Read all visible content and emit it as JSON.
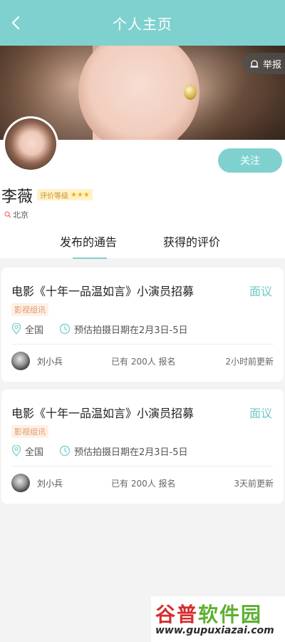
{
  "header": {
    "title": "个人主页"
  },
  "cover": {
    "report_label": "举报"
  },
  "profile": {
    "name": "李薇",
    "rating_label": "评价等级",
    "stars": "★★★",
    "location": "北京",
    "follow_label": "关注"
  },
  "tabs": [
    {
      "label": "发布的通告",
      "active": true
    },
    {
      "label": "获得的评价",
      "active": false
    }
  ],
  "cards": [
    {
      "title": "电影《十年一品温如言》小演员招募",
      "price": "面议",
      "tag": "影视组讯",
      "location": "全国",
      "date_text": "预估拍摄日期在2月3日-5日",
      "poster": "刘小兵",
      "signup": "已有 200人 报名",
      "updated": "2小时前更新"
    },
    {
      "title": "电影《十年一品温如言》小演员招募",
      "price": "面议",
      "tag": "影视组讯",
      "location": "全国",
      "date_text": "预估拍摄日期在2月3日-5日",
      "poster": "刘小兵",
      "signup": "已有 200人 报名",
      "updated": "3天前更新"
    }
  ],
  "watermark": {
    "logo_a": "谷普",
    "logo_b": "软件园",
    "url": "www.gupuxiazai.com"
  },
  "colors": {
    "accent": "#7fd1cf",
    "price": "#6cc9c5",
    "tag_bg": "#fff0e6",
    "tag_text": "#e0996a",
    "star": "#f2b318"
  }
}
